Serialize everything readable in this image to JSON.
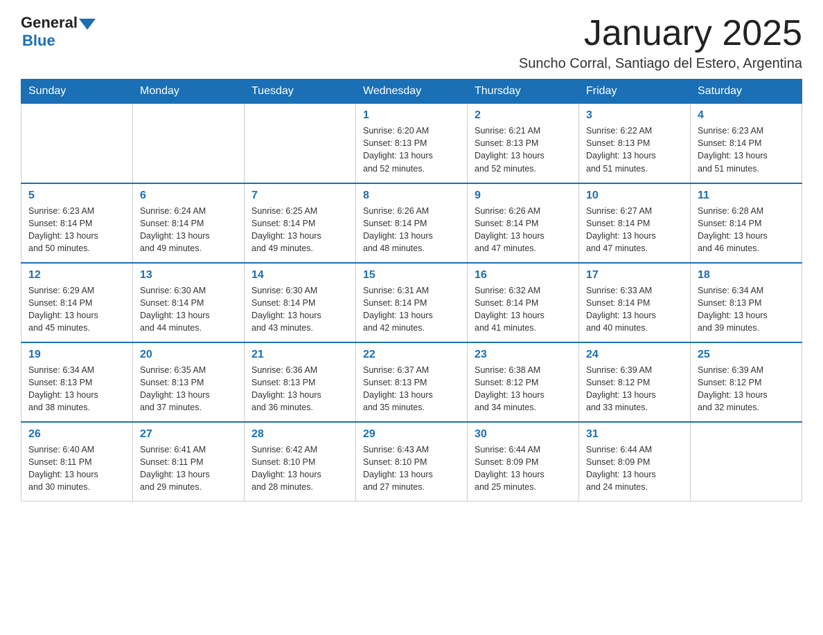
{
  "header": {
    "logo_general": "General",
    "logo_blue": "Blue",
    "month_title": "January 2025",
    "location": "Suncho Corral, Santiago del Estero, Argentina"
  },
  "days_of_week": [
    "Sunday",
    "Monday",
    "Tuesday",
    "Wednesday",
    "Thursday",
    "Friday",
    "Saturday"
  ],
  "weeks": [
    [
      {
        "day": "",
        "info": ""
      },
      {
        "day": "",
        "info": ""
      },
      {
        "day": "",
        "info": ""
      },
      {
        "day": "1",
        "info": "Sunrise: 6:20 AM\nSunset: 8:13 PM\nDaylight: 13 hours\nand 52 minutes."
      },
      {
        "day": "2",
        "info": "Sunrise: 6:21 AM\nSunset: 8:13 PM\nDaylight: 13 hours\nand 52 minutes."
      },
      {
        "day": "3",
        "info": "Sunrise: 6:22 AM\nSunset: 8:13 PM\nDaylight: 13 hours\nand 51 minutes."
      },
      {
        "day": "4",
        "info": "Sunrise: 6:23 AM\nSunset: 8:14 PM\nDaylight: 13 hours\nand 51 minutes."
      }
    ],
    [
      {
        "day": "5",
        "info": "Sunrise: 6:23 AM\nSunset: 8:14 PM\nDaylight: 13 hours\nand 50 minutes."
      },
      {
        "day": "6",
        "info": "Sunrise: 6:24 AM\nSunset: 8:14 PM\nDaylight: 13 hours\nand 49 minutes."
      },
      {
        "day": "7",
        "info": "Sunrise: 6:25 AM\nSunset: 8:14 PM\nDaylight: 13 hours\nand 49 minutes."
      },
      {
        "day": "8",
        "info": "Sunrise: 6:26 AM\nSunset: 8:14 PM\nDaylight: 13 hours\nand 48 minutes."
      },
      {
        "day": "9",
        "info": "Sunrise: 6:26 AM\nSunset: 8:14 PM\nDaylight: 13 hours\nand 47 minutes."
      },
      {
        "day": "10",
        "info": "Sunrise: 6:27 AM\nSunset: 8:14 PM\nDaylight: 13 hours\nand 47 minutes."
      },
      {
        "day": "11",
        "info": "Sunrise: 6:28 AM\nSunset: 8:14 PM\nDaylight: 13 hours\nand 46 minutes."
      }
    ],
    [
      {
        "day": "12",
        "info": "Sunrise: 6:29 AM\nSunset: 8:14 PM\nDaylight: 13 hours\nand 45 minutes."
      },
      {
        "day": "13",
        "info": "Sunrise: 6:30 AM\nSunset: 8:14 PM\nDaylight: 13 hours\nand 44 minutes."
      },
      {
        "day": "14",
        "info": "Sunrise: 6:30 AM\nSunset: 8:14 PM\nDaylight: 13 hours\nand 43 minutes."
      },
      {
        "day": "15",
        "info": "Sunrise: 6:31 AM\nSunset: 8:14 PM\nDaylight: 13 hours\nand 42 minutes."
      },
      {
        "day": "16",
        "info": "Sunrise: 6:32 AM\nSunset: 8:14 PM\nDaylight: 13 hours\nand 41 minutes."
      },
      {
        "day": "17",
        "info": "Sunrise: 6:33 AM\nSunset: 8:14 PM\nDaylight: 13 hours\nand 40 minutes."
      },
      {
        "day": "18",
        "info": "Sunrise: 6:34 AM\nSunset: 8:13 PM\nDaylight: 13 hours\nand 39 minutes."
      }
    ],
    [
      {
        "day": "19",
        "info": "Sunrise: 6:34 AM\nSunset: 8:13 PM\nDaylight: 13 hours\nand 38 minutes."
      },
      {
        "day": "20",
        "info": "Sunrise: 6:35 AM\nSunset: 8:13 PM\nDaylight: 13 hours\nand 37 minutes."
      },
      {
        "day": "21",
        "info": "Sunrise: 6:36 AM\nSunset: 8:13 PM\nDaylight: 13 hours\nand 36 minutes."
      },
      {
        "day": "22",
        "info": "Sunrise: 6:37 AM\nSunset: 8:13 PM\nDaylight: 13 hours\nand 35 minutes."
      },
      {
        "day": "23",
        "info": "Sunrise: 6:38 AM\nSunset: 8:12 PM\nDaylight: 13 hours\nand 34 minutes."
      },
      {
        "day": "24",
        "info": "Sunrise: 6:39 AM\nSunset: 8:12 PM\nDaylight: 13 hours\nand 33 minutes."
      },
      {
        "day": "25",
        "info": "Sunrise: 6:39 AM\nSunset: 8:12 PM\nDaylight: 13 hours\nand 32 minutes."
      }
    ],
    [
      {
        "day": "26",
        "info": "Sunrise: 6:40 AM\nSunset: 8:11 PM\nDaylight: 13 hours\nand 30 minutes."
      },
      {
        "day": "27",
        "info": "Sunrise: 6:41 AM\nSunset: 8:11 PM\nDaylight: 13 hours\nand 29 minutes."
      },
      {
        "day": "28",
        "info": "Sunrise: 6:42 AM\nSunset: 8:10 PM\nDaylight: 13 hours\nand 28 minutes."
      },
      {
        "day": "29",
        "info": "Sunrise: 6:43 AM\nSunset: 8:10 PM\nDaylight: 13 hours\nand 27 minutes."
      },
      {
        "day": "30",
        "info": "Sunrise: 6:44 AM\nSunset: 8:09 PM\nDaylight: 13 hours\nand 25 minutes."
      },
      {
        "day": "31",
        "info": "Sunrise: 6:44 AM\nSunset: 8:09 PM\nDaylight: 13 hours\nand 24 minutes."
      },
      {
        "day": "",
        "info": ""
      }
    ]
  ]
}
